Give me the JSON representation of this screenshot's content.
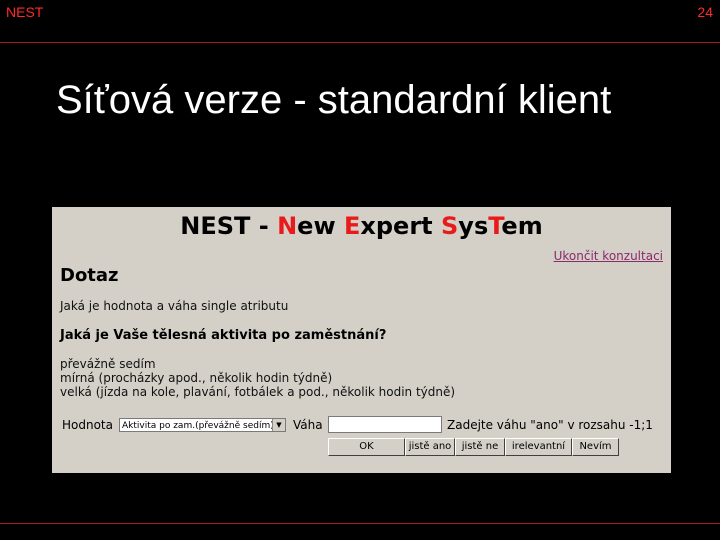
{
  "slide": {
    "header_left": "NEST",
    "page_number": "24",
    "title": "Síťová verze - standardní klient"
  },
  "app": {
    "title_parts": [
      {
        "text": "NEST - ",
        "red": false
      },
      {
        "text": "N",
        "red": true
      },
      {
        "text": "ew ",
        "red": false
      },
      {
        "text": "E",
        "red": true
      },
      {
        "text": "xpert ",
        "red": false
      },
      {
        "text": "S",
        "red": true
      },
      {
        "text": "ys",
        "red": false
      },
      {
        "text": "T",
        "red": true
      },
      {
        "text": "em",
        "red": false
      }
    ],
    "end_link": "Ukončit konzultaci",
    "section_heading": "Dotaz",
    "question_sub": "Jaká je hodnota a váha single atributu",
    "question_main": "Jaká je Vaše tělesná aktivita po zaměstnání?",
    "options": [
      "převážně sedím",
      "mírná (procházky apod., několik hodin týdně)",
      "velká (jízda na kole, plavání, fotbálek a pod., několik hodin týdně)"
    ],
    "value_label": "Hodnota",
    "value_selected": "Aktivita po zam.(převážně sedím)",
    "weight_label": "Váha",
    "weight_value": "",
    "weight_hint": "Zadejte váhu \"ano\" v rozsahu -1;1",
    "buttons": {
      "ok": "OK",
      "sure_yes": "jistě ano",
      "sure_no": "jistě ne",
      "irrelevant": "irelevantní",
      "dont_know": "Nevím"
    }
  }
}
